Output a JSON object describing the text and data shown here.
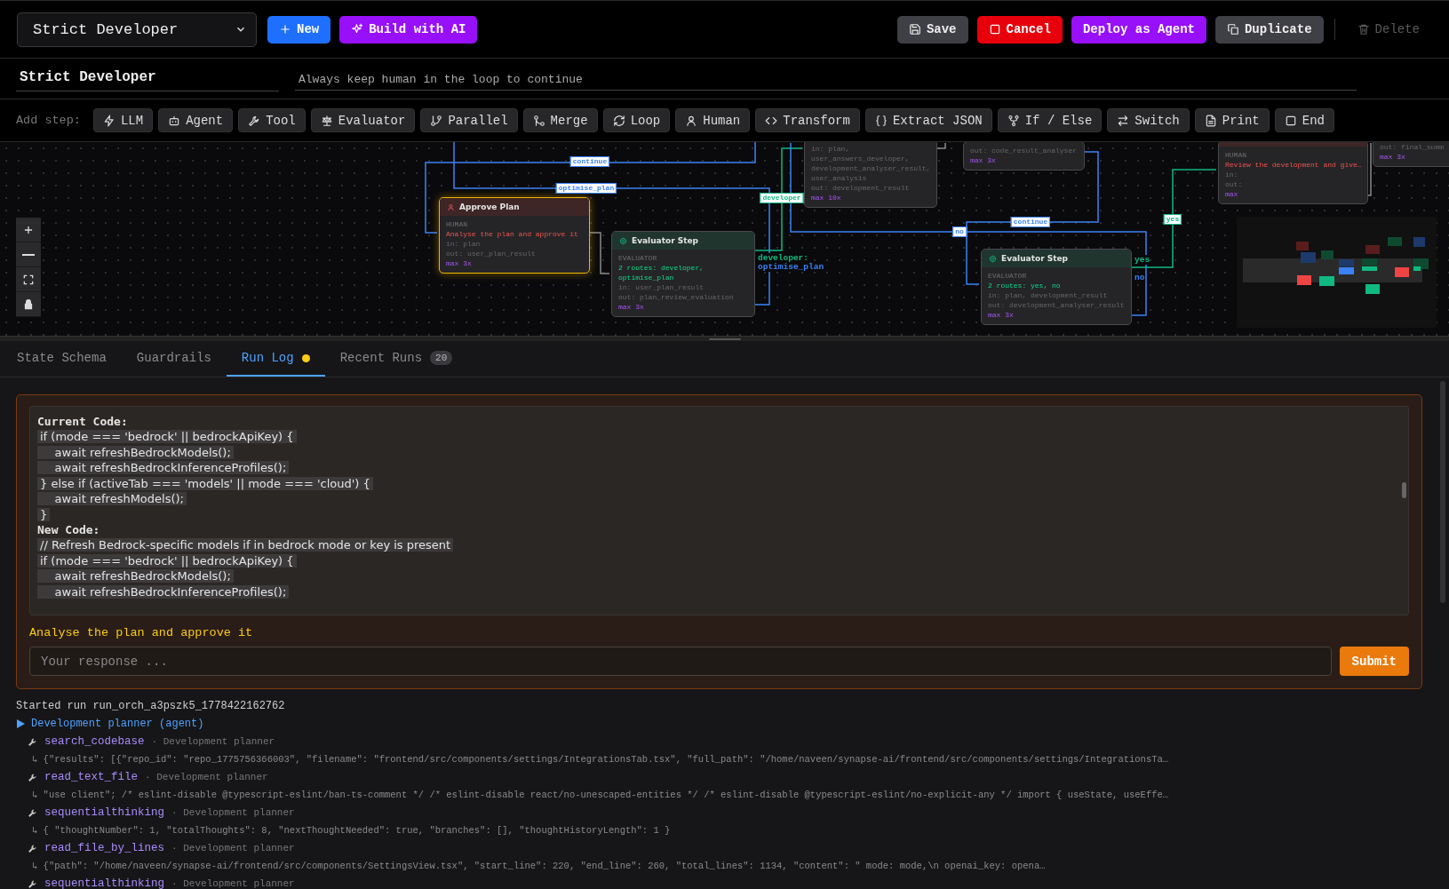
{
  "toolbar": {
    "workflow_select": "Strict Developer",
    "left_buttons": [
      {
        "label": "New",
        "kind": "new"
      },
      {
        "label": "Build with AI",
        "kind": "ai"
      }
    ],
    "right_buttons": [
      {
        "label": "Save",
        "kind": "save",
        "disabled": false
      },
      {
        "label": "Cancel",
        "kind": "cancel",
        "disabled": false
      },
      {
        "label": "Deploy as Agent",
        "kind": "deploy",
        "disabled": false
      },
      {
        "label": "Duplicate",
        "kind": "duplicate",
        "disabled": false
      },
      {
        "label": "Delete",
        "kind": "delete",
        "disabled": true
      }
    ]
  },
  "workflow": {
    "name": "Strict Developer",
    "description": "Always keep human in the loop to continue"
  },
  "add_step": {
    "label": "Add step:",
    "items": [
      {
        "label": "LLM",
        "kind": "llm"
      },
      {
        "label": "Agent",
        "kind": "agent"
      },
      {
        "label": "Tool",
        "kind": "tool"
      },
      {
        "label": "Evaluator",
        "kind": "evaluator"
      },
      {
        "label": "Parallel",
        "kind": "parallel"
      },
      {
        "label": "Merge",
        "kind": "merge"
      },
      {
        "label": "Loop",
        "kind": "loop"
      },
      {
        "label": "Human",
        "kind": "human"
      },
      {
        "label": "Transform",
        "kind": "transform"
      },
      {
        "label": "Extract JSON",
        "kind": "extract"
      },
      {
        "label": "If / Else",
        "kind": "ifelse"
      },
      {
        "label": "Switch",
        "kind": "switch"
      },
      {
        "label": "Print",
        "kind": "print"
      },
      {
        "label": "End",
        "kind": "end"
      }
    ]
  },
  "canvas": {
    "nodes": [
      {
        "inputs": "in: plan, user_answers_developer, development_analyser_result, user_analysis",
        "output": "out: development_result",
        "max": "max 10x",
        "selected": false
      },
      {
        "output": "out: code_result_analyser",
        "max": "max 3x",
        "selected": false
      },
      {
        "kind": "human",
        "type_label": "HUMAN",
        "detail": "Review the development and give…",
        "inputs": "in:",
        "output": "out:",
        "max": "max",
        "selected": false
      },
      {
        "output": "out: final_summ",
        "max": "max 3x",
        "selected": false
      },
      {
        "kind": "human",
        "title": "Approve Plan",
        "type_label": "HUMAN",
        "detail": "Analyse the plan and approve it",
        "inputs": "in: plan",
        "output": "out: user_plan_result",
        "max": "max 3x",
        "selected": true
      },
      {
        "kind": "evaluator",
        "title": "Evaluator Step",
        "type_label": "EVALUATOR",
        "detail": "2 routes: developer, optimise_plan",
        "inputs": "in: user_plan_result",
        "output": "out: plan_review_evaluation",
        "max": "max 3x",
        "selected": false
      },
      {
        "kind": "evaluator",
        "title": "Evaluator Step",
        "type_label": "EVALUATOR",
        "detail": "2 routes: yes, no",
        "inputs": "in: plan, development_result",
        "output": "out: development_analyser_result",
        "max": "max 3x",
        "selected": false
      }
    ],
    "edge_labels": [
      {
        "text": "continue",
        "color": "#3b82f6"
      },
      {
        "text": "optimise_plan",
        "color": "#3b82f6"
      },
      {
        "text": "developer",
        "color": "#10b981"
      },
      {
        "text": "no",
        "color": "#3b82f6"
      },
      {
        "text": "continue",
        "color": "#3b82f6"
      },
      {
        "text": "yes",
        "color": "#10b981"
      }
    ],
    "port_labels": [
      {
        "text": "developer:",
        "color": "#10b981"
      },
      {
        "text": "optimise_plan",
        "color": "#3b82f6"
      },
      {
        "text": "yes",
        "color": "#10b981"
      },
      {
        "text": "no",
        "color": "#3b82f6"
      }
    ]
  },
  "tabs": [
    {
      "label": "State Schema",
      "selected": false
    },
    {
      "label": "Guardrails",
      "selected": false
    },
    {
      "label": "Run Log",
      "selected": true,
      "live": true
    },
    {
      "label": "Recent Runs",
      "selected": false,
      "count": "20"
    }
  ],
  "approval": {
    "sections": [
      {
        "heading": "Current Code:",
        "lines": [
          "if (mode === 'bedrock' || bedrockApiKey) {",
          "    await refreshBedrockModels();",
          "    await refreshBedrockInferenceProfiles();",
          "} else if (activeTab === 'models' || mode === 'cloud') {",
          "    await refreshModels();",
          "}"
        ]
      },
      {
        "heading": "New Code:",
        "lines": [
          "// Refresh Bedrock-specific models if in bedrock mode or key is present",
          "if (mode === 'bedrock' || bedrockApiKey) {",
          "    await refreshBedrockModels();",
          "    await refreshBedrockInferenceProfiles();"
        ]
      }
    ],
    "question": "Analyse the plan and approve it",
    "placeholder": "Your response ...",
    "submit": "Submit"
  },
  "log": {
    "started": "Started run run_orch_a3pszk5_1778422162762",
    "agent": "Development planner (agent)",
    "entries": [
      {
        "tool": "search_codebase",
        "source": "· Development planner",
        "result": "↳ {\"results\": [{\"repo_id\": \"repo_1775756366003\", \"filename\": \"frontend/src/components/settings/IntegrationsTab.tsx\", \"full_path\": \"/home/naveen/synapse-ai/frontend/src/components/settings/IntegrationsTa…"
      },
      {
        "tool": "read_text_file",
        "source": "· Development planner",
        "result": "↳ \"use client\"; /* eslint-disable @typescript-eslint/ban-ts-comment */ /* eslint-disable react/no-unescaped-entities */ /* eslint-disable @typescript-eslint/no-explicit-any */ import { useState, useEffe…"
      },
      {
        "tool": "sequentialthinking",
        "source": "· Development planner",
        "result": "↳ { \"thoughtNumber\": 1, \"totalThoughts\": 8, \"nextThoughtNeeded\": true, \"branches\": [], \"thoughtHistoryLength\": 1 }"
      },
      {
        "tool": "read_file_by_lines",
        "source": "· Development planner",
        "result": "↳ {\"path\": \"/home/naveen/synapse-ai/frontend/src/components/SettingsView.tsx\", \"start_line\": 220, \"end_line\": 260, \"total_lines\": 1134, \"content\": \" mode: mode,\\n openai_key: opena…"
      },
      {
        "tool": "sequentialthinking",
        "source": "· Development planner"
      }
    ]
  }
}
